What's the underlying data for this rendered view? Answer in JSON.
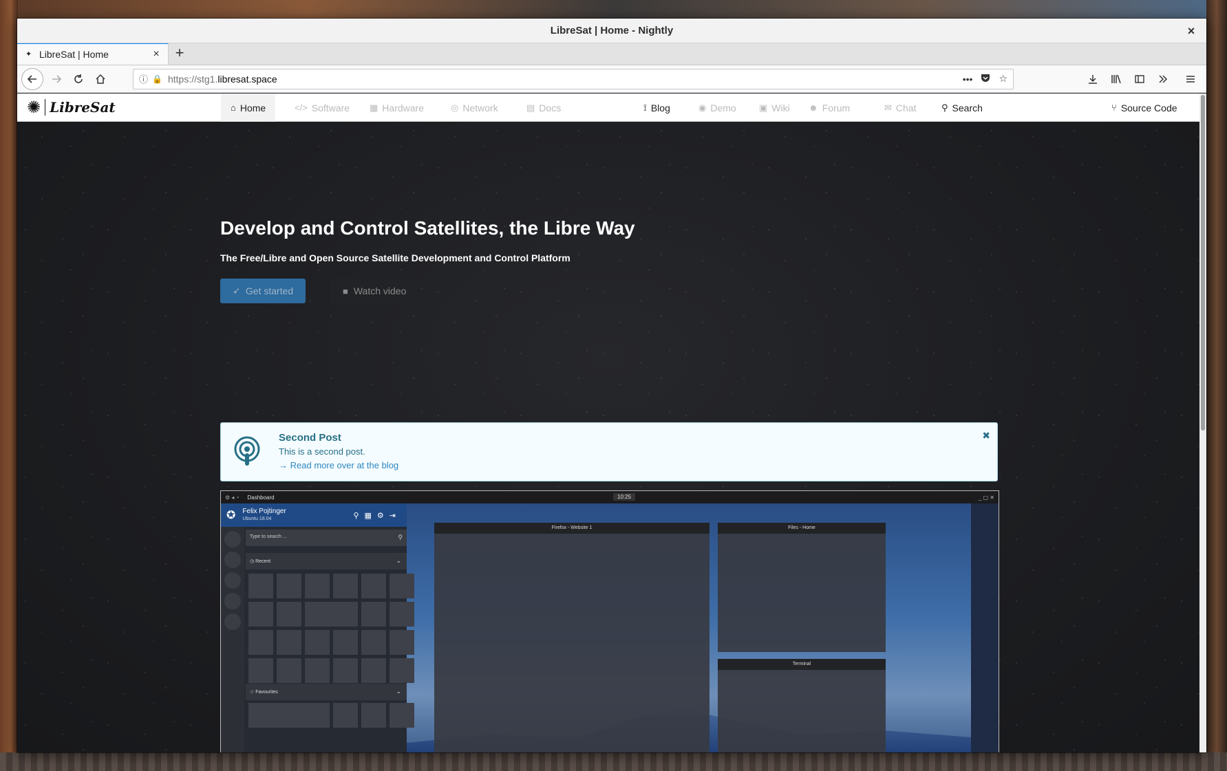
{
  "window": {
    "title": "LibreSat | Home - Nightly",
    "close": "×"
  },
  "tabs": [
    {
      "label": "LibreSat | Home",
      "close": "×",
      "favicon": "✦"
    }
  ],
  "newtab": "+",
  "urlbar": {
    "url_prefix": "https://stg1.",
    "url_host": "libresat.space",
    "menu": "•••"
  },
  "site": {
    "logo_text": "LibreSat",
    "nav": {
      "home": "Home",
      "software": "Software",
      "hardware": "Hardware",
      "network": "Network",
      "docs": "Docs",
      "blog": "Blog",
      "demo": "Demo",
      "wiki": "Wiki",
      "forum": "Forum",
      "chat": "Chat",
      "search": "Search",
      "source": "Source Code"
    }
  },
  "hero": {
    "title": "Develop and Control Satellites, the Libre Way",
    "subtitle": "The Free/Libre and Open Source Satellite Development and Control Platform",
    "primary_button": "Get started",
    "secondary_button": "Watch video"
  },
  "post": {
    "title": "Second Post",
    "body": "This is a second post.",
    "link": "Read more over at the blog",
    "close": "✖"
  },
  "screenshot": {
    "topbar_label": "Dashboard",
    "clock": "10:25",
    "user_name": "Felix Pojtinger",
    "user_os": "Ubuntu 18.04",
    "search_placeholder": "Type to search ...",
    "recent_label": "Recent",
    "favourites_label": "Favourites",
    "panel_firefox": "Firefox - Website 1",
    "panel_files": "Files - Home",
    "panel_terminal": "Terminal"
  },
  "colors": {
    "primary": "#2e6b9e",
    "post_bg": "#f4fcff",
    "post_text": "#276f86",
    "tab_accent": "#0a84ff"
  }
}
